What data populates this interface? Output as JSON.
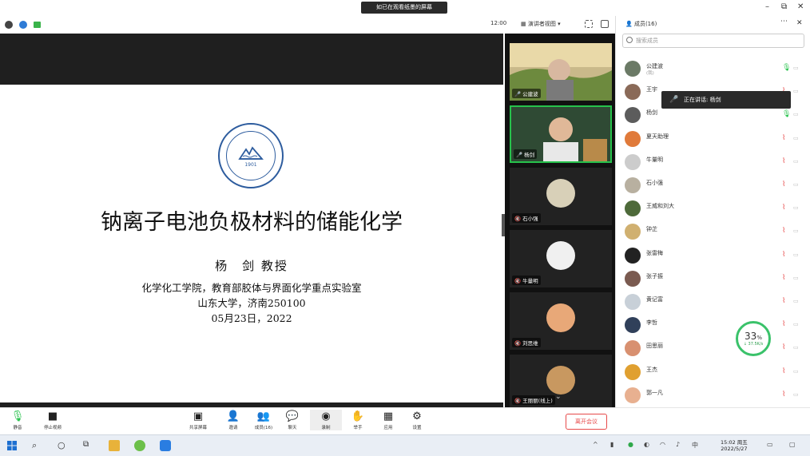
{
  "window": {
    "notice": "如已在观看纸墨的屏幕",
    "minimize": "–",
    "restore": "⧉",
    "close": "✕"
  },
  "toolbar": {
    "time": "12:00",
    "view_mode": "演讲者视图",
    "view_arrow": "▾"
  },
  "slide": {
    "title": "钠离子电池负极材料的储能化学",
    "author": "杨　剑 教授",
    "affiliation": "化学化工学院，教育部胶体与界面化学重点实验室",
    "university": "山东大学，济南250100",
    "date": "05月23日，2022",
    "logo_year": "1901"
  },
  "video_tiles": [
    {
      "name": "公建波"
    },
    {
      "name": "杨剑"
    },
    {
      "name": "石小强"
    },
    {
      "name": "牛量明"
    },
    {
      "name": "刘思维"
    },
    {
      "name": "王丽丽(线上)"
    }
  ],
  "participants_panel": {
    "title": "成员(16)",
    "search_placeholder": "搜索成员",
    "speaking_tip": "正在讲话: 杨剑",
    "items": [
      {
        "name": "公建波",
        "sub": "(我)",
        "avatar_color": "#6b7a66",
        "mic": "on"
      },
      {
        "name": "王宇",
        "sub": "",
        "avatar_color": "#8a6a58",
        "mic": "off"
      },
      {
        "name": "杨剑",
        "sub": "",
        "avatar_color": "#5c5c5c",
        "mic": "on"
      },
      {
        "name": "夏天助理",
        "sub": "",
        "avatar_color": "#e07a3a",
        "mic": "off"
      },
      {
        "name": "牛量明",
        "sub": "",
        "avatar_color": "#cccccc",
        "mic": "off"
      },
      {
        "name": "石小强",
        "sub": "",
        "avatar_color": "#b8b0a0",
        "mic": "off"
      },
      {
        "name": "王威和刘大",
        "sub": "",
        "avatar_color": "#4e6a3a",
        "mic": "off"
      },
      {
        "name": "钟芷",
        "sub": "",
        "avatar_color": "#d0b070",
        "mic": "off"
      },
      {
        "name": "张雷梅",
        "sub": "",
        "avatar_color": "#222222",
        "mic": "off"
      },
      {
        "name": "张子振",
        "sub": "",
        "avatar_color": "#7a5a50",
        "mic": "off"
      },
      {
        "name": "黄记富",
        "sub": "",
        "avatar_color": "#c8d0d8",
        "mic": "off"
      },
      {
        "name": "李哲",
        "sub": "",
        "avatar_color": "#30405a",
        "mic": "off"
      },
      {
        "name": "田思丽",
        "sub": "",
        "avatar_color": "#d89070",
        "mic": "off"
      },
      {
        "name": "王杰",
        "sub": "",
        "avatar_color": "#e0a030",
        "mic": "off"
      },
      {
        "name": "郭一凡",
        "sub": "",
        "avatar_color": "#e8b090",
        "mic": "off"
      }
    ]
  },
  "network_gauge": {
    "value": "33",
    "unit": "%",
    "sub": "↓ 37.5K/s"
  },
  "controls": {
    "mute": "静音",
    "stop_video": "停止视频",
    "share": "共享屏幕",
    "invite": "邀请",
    "members": "成员(16)",
    "chat": "聊天",
    "record": "录制",
    "raise_hand": "举手",
    "apps": "应用",
    "settings": "设置",
    "leave": "离开会议"
  },
  "taskbar": {
    "clock_time": "15:02 周五",
    "clock_date": "2022/5/27"
  },
  "colors": {
    "accent_green": "#27c24c",
    "leave_red": "#e74a4a",
    "logo_blue": "#2d5c9e"
  }
}
